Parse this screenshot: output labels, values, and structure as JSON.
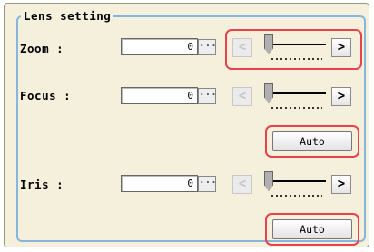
{
  "group_title": "Lens setting",
  "zoom": {
    "label": "Zoom :",
    "value": "0",
    "dots": "···",
    "left": "<",
    "right": ">"
  },
  "focus": {
    "label": "Focus :",
    "value": "0",
    "dots": "···",
    "left": "<",
    "right": ">",
    "auto": "Auto"
  },
  "iris": {
    "label": "Iris :",
    "value": "0",
    "dots": "···",
    "left": "<",
    "right": ">",
    "auto": "Auto"
  },
  "colors": {
    "highlight": "#e8424d",
    "panel": "#f4f0dc",
    "group_border": "#86b6dc"
  }
}
